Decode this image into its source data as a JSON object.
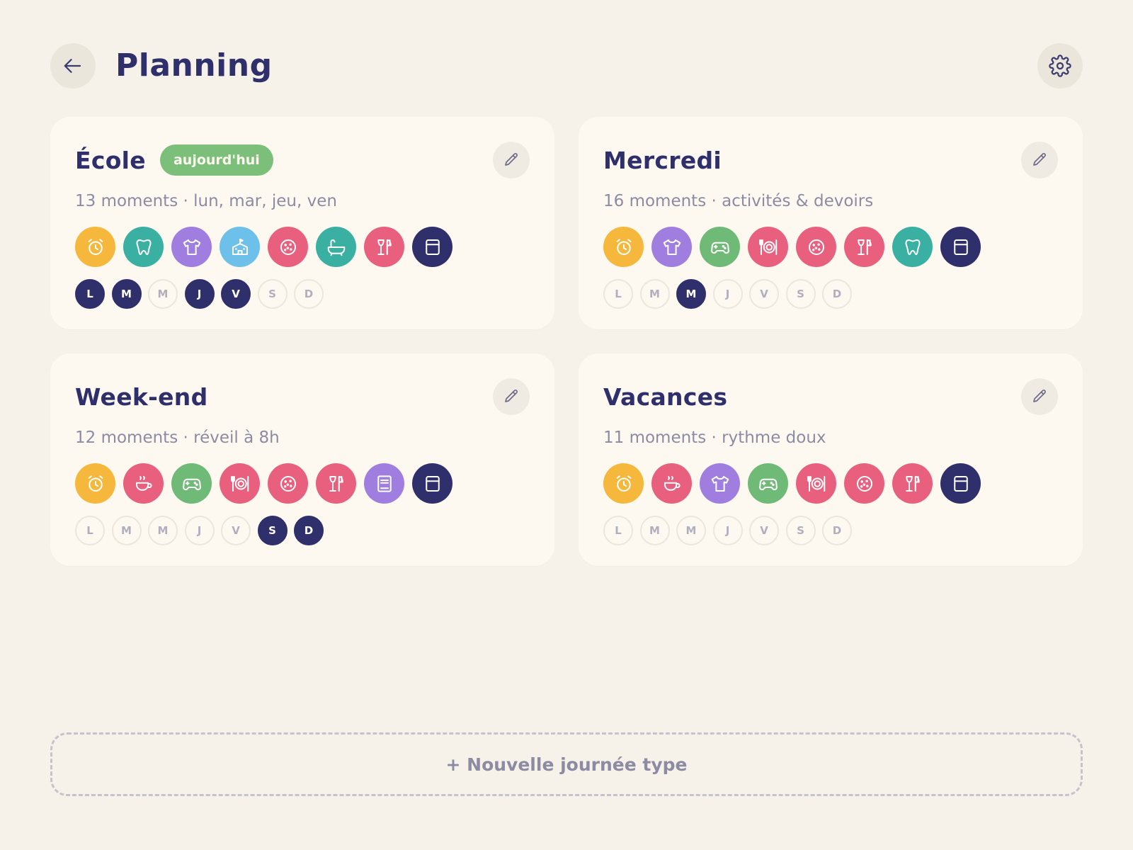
{
  "header": {
    "title": "Planning",
    "back_icon": "arrow-left-icon",
    "settings_icon": "gear-icon"
  },
  "colors": {
    "primary": "#2e2f6b",
    "background": "#f6f2e9",
    "card": "#fdf9f0",
    "badge": "#7cbf7a",
    "yellow": "#f5b83d",
    "teal": "#3ab0a3",
    "purple": "#a07ee0",
    "lightblue": "#6cc0ea",
    "pink": "#e8607e",
    "green": "#6fba77",
    "navy": "#2e2f6b"
  },
  "cards": [
    {
      "title": "École",
      "badge": "aujourd'hui",
      "subtitle": "13 moments · lun, mar, jeu, ven",
      "moments": [
        {
          "icon": "alarm-clock-icon",
          "color": "yellow"
        },
        {
          "icon": "tooth-icon",
          "color": "teal"
        },
        {
          "icon": "tshirt-icon",
          "color": "purple"
        },
        {
          "icon": "school-icon",
          "color": "lightblue"
        },
        {
          "icon": "cookie-icon",
          "color": "pink"
        },
        {
          "icon": "bathtub-icon",
          "color": "teal"
        },
        {
          "icon": "dinner-icon",
          "color": "pink"
        },
        {
          "icon": "bed-icon",
          "color": "navy"
        }
      ],
      "days": [
        {
          "label": "L",
          "on": true
        },
        {
          "label": "M",
          "on": true
        },
        {
          "label": "M",
          "on": false
        },
        {
          "label": "J",
          "on": true
        },
        {
          "label": "V",
          "on": true
        },
        {
          "label": "S",
          "on": false
        },
        {
          "label": "D",
          "on": false
        }
      ]
    },
    {
      "title": "Mercredi",
      "badge": "",
      "subtitle": "16 moments · activités & devoirs",
      "moments": [
        {
          "icon": "alarm-clock-icon",
          "color": "yellow"
        },
        {
          "icon": "tshirt-icon",
          "color": "purple"
        },
        {
          "icon": "gamepad-icon",
          "color": "green"
        },
        {
          "icon": "plate-icon",
          "color": "pink"
        },
        {
          "icon": "cookie-icon",
          "color": "pink"
        },
        {
          "icon": "dinner-icon",
          "color": "pink"
        },
        {
          "icon": "tooth-icon",
          "color": "teal"
        },
        {
          "icon": "bed-icon",
          "color": "navy"
        }
      ],
      "days": [
        {
          "label": "L",
          "on": false
        },
        {
          "label": "M",
          "on": false
        },
        {
          "label": "M",
          "on": true
        },
        {
          "label": "J",
          "on": false
        },
        {
          "label": "V",
          "on": false
        },
        {
          "label": "S",
          "on": false
        },
        {
          "label": "D",
          "on": false
        }
      ]
    },
    {
      "title": "Week-end",
      "badge": "",
      "subtitle": "12 moments · réveil à 8h",
      "moments": [
        {
          "icon": "alarm-clock-icon",
          "color": "yellow"
        },
        {
          "icon": "breakfast-icon",
          "color": "pink"
        },
        {
          "icon": "gamepad-icon",
          "color": "green"
        },
        {
          "icon": "plate-icon",
          "color": "pink"
        },
        {
          "icon": "cookie-icon",
          "color": "pink"
        },
        {
          "icon": "dinner-icon",
          "color": "pink"
        },
        {
          "icon": "book-icon",
          "color": "purple"
        },
        {
          "icon": "bed-icon",
          "color": "navy"
        }
      ],
      "days": [
        {
          "label": "L",
          "on": false
        },
        {
          "label": "M",
          "on": false
        },
        {
          "label": "M",
          "on": false
        },
        {
          "label": "J",
          "on": false
        },
        {
          "label": "V",
          "on": false
        },
        {
          "label": "S",
          "on": true
        },
        {
          "label": "D",
          "on": true
        }
      ]
    },
    {
      "title": "Vacances",
      "badge": "",
      "subtitle": "11 moments · rythme doux",
      "moments": [
        {
          "icon": "alarm-clock-icon",
          "color": "yellow"
        },
        {
          "icon": "breakfast-icon",
          "color": "pink"
        },
        {
          "icon": "tshirt-icon",
          "color": "purple"
        },
        {
          "icon": "gamepad-icon",
          "color": "green"
        },
        {
          "icon": "plate-icon",
          "color": "pink"
        },
        {
          "icon": "cookie-icon",
          "color": "pink"
        },
        {
          "icon": "dinner-icon",
          "color": "pink"
        },
        {
          "icon": "bed-icon",
          "color": "navy"
        }
      ],
      "days": [
        {
          "label": "L",
          "on": false
        },
        {
          "label": "M",
          "on": false
        },
        {
          "label": "M",
          "on": false
        },
        {
          "label": "J",
          "on": false
        },
        {
          "label": "V",
          "on": false
        },
        {
          "label": "S",
          "on": false
        },
        {
          "label": "D",
          "on": false
        }
      ]
    }
  ],
  "new_button": {
    "label": "+ Nouvelle journée type"
  }
}
